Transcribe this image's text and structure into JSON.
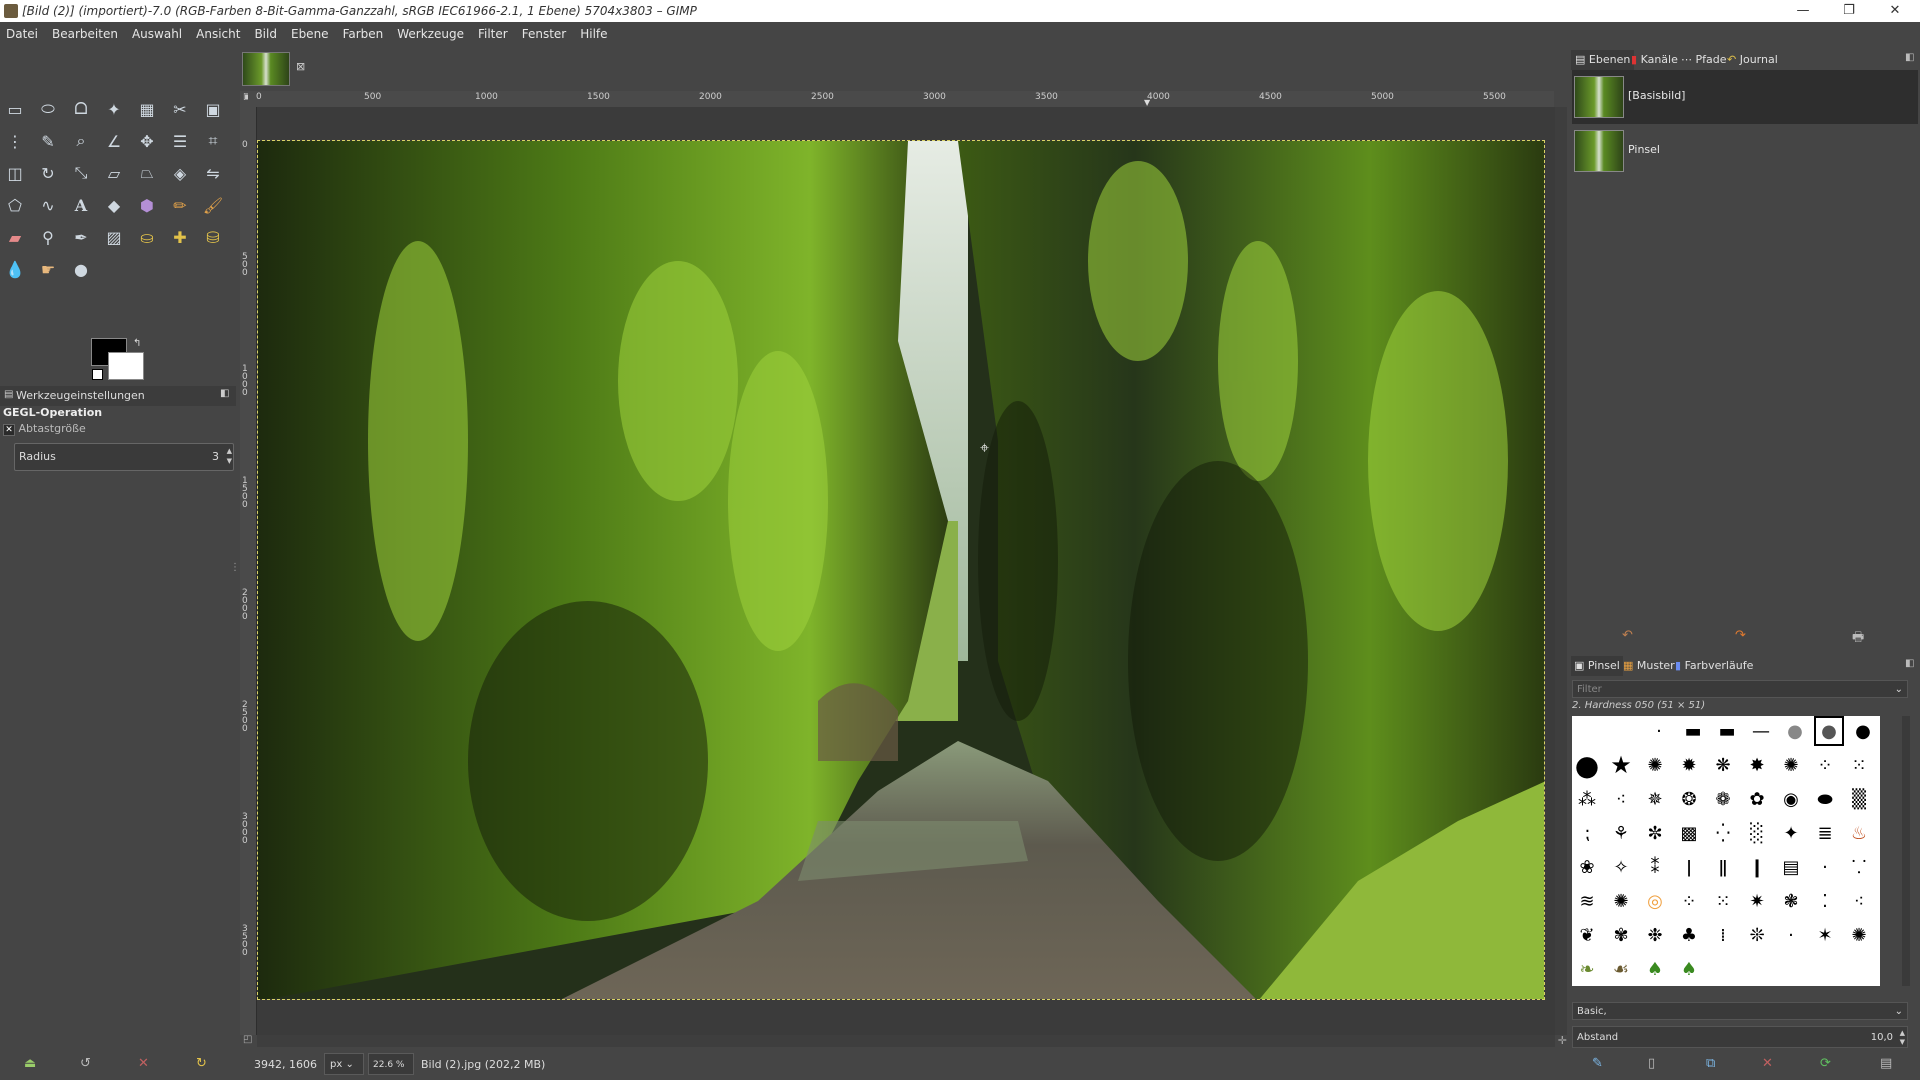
{
  "window": {
    "title": "[Bild (2)] (importiert)-7.0 (RGB-Farben 8-Bit-Gamma-Ganzzahl, sRGB IEC61966-2.1, 1 Ebene) 5704x3803 – GIMP",
    "minimize": "—",
    "maximize": "❐",
    "close": "✕"
  },
  "menu": [
    "Datei",
    "Bearbeiten",
    "Auswahl",
    "Ansicht",
    "Bild",
    "Ebene",
    "Farben",
    "Werkzeuge",
    "Filter",
    "Fenster",
    "Hilfe"
  ],
  "tool_options": {
    "tab_label": "Werkzeugeinstellungen",
    "title": "GEGL-Operation",
    "sample_label": "Abtastgröße",
    "radius_label": "Radius",
    "radius_value": "3"
  },
  "image_tab": {
    "close": "⊠"
  },
  "ruler": {
    "h_ticks": [
      "0",
      "500",
      "1000",
      "1500",
      "2000",
      "2500",
      "3000",
      "3500",
      "4000",
      "4500",
      "5000",
      "5500"
    ],
    "v_ticks": [
      "0",
      "500",
      "1000",
      "1500",
      "2000",
      "2500",
      "3000",
      "3500"
    ]
  },
  "status": {
    "coords": "3942, 1606",
    "unit": "px",
    "zoom": "22.6 %",
    "message": "Bild (2).jpg (202,2 MB)"
  },
  "layers_dock": {
    "tabs": [
      "Ebenen",
      "Kanäle",
      "Pfade",
      "Journal"
    ],
    "rows": [
      "[Basisbild]",
      "Pinsel"
    ]
  },
  "brushes_dock": {
    "tabs": [
      "Pinsel",
      "Muster",
      "Farbverläufe"
    ],
    "filter_placeholder": "Filter",
    "selected_brush": "2. Hardness 050 (51 × 51)",
    "preset": "Basic,",
    "spacing_label": "Abstand",
    "spacing_value": "10,0"
  },
  "colors": {
    "foreground": "#000000",
    "background": "#ffffff",
    "selection": "#d9d266"
  }
}
